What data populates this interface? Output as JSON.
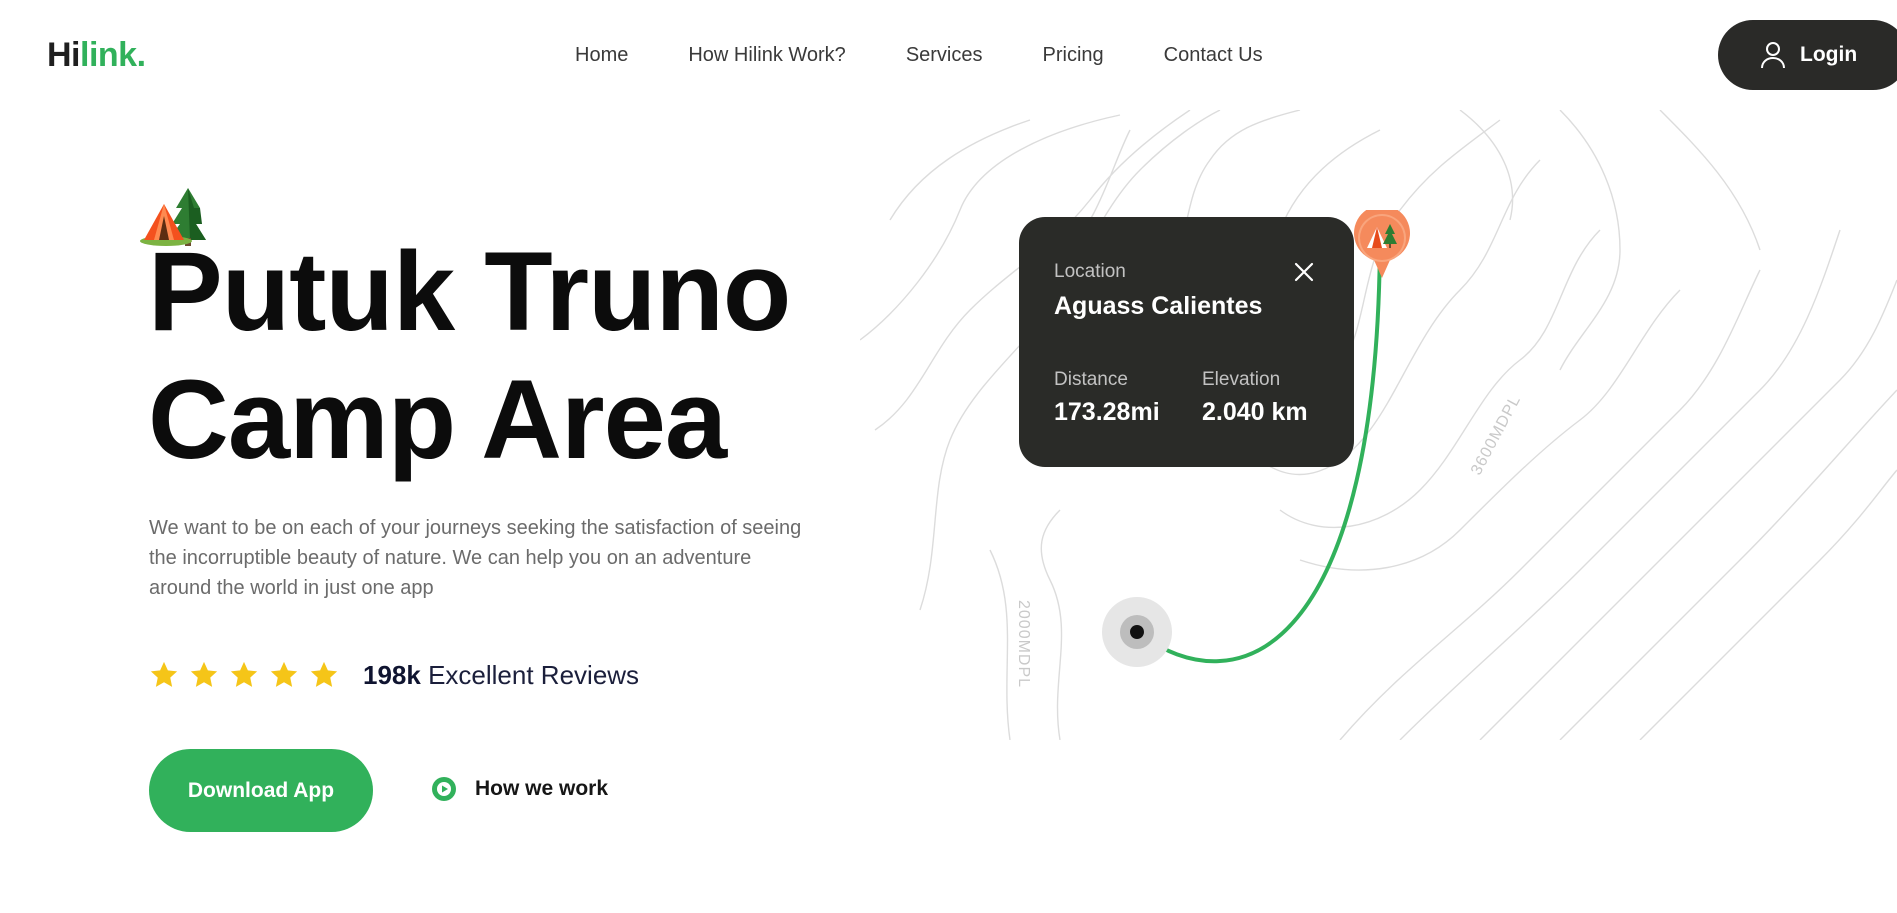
{
  "header": {
    "logo_part1": "Hi",
    "logo_part2": "link.",
    "nav": [
      "Home",
      "How Hilink Work?",
      "Services",
      "Pricing",
      "Contact Us"
    ],
    "login_label": "Login"
  },
  "hero": {
    "title_line1": "Putuk Truno",
    "title_line2": "Camp Area",
    "description": "We want to be on each of your journeys seeking the satisfaction of seeing the incorruptible beauty of nature. We can help you on an adventure around the world in just one app",
    "rating_stars": 5,
    "reviews_count": "198k",
    "reviews_label": "Excellent Reviews",
    "download_label": "Download App",
    "how_we_work_label": "How we work"
  },
  "map": {
    "altitude_labels": [
      "2000MDPL",
      "3600MDPL"
    ],
    "card": {
      "location_label": "Location",
      "location_name": "Aguass Calientes",
      "distance_label": "Distance",
      "distance_value": "173.28mi",
      "elevation_label": "Elevation",
      "elevation_value": "2.040 km"
    }
  },
  "colors": {
    "brand_green": "#31b15b",
    "dark": "#2a2b28",
    "star": "#f5c518",
    "pin_orange": "#f58a5c"
  },
  "icons": [
    "user-icon",
    "camp-icon",
    "star-icon",
    "close-icon",
    "play-icon",
    "location-pin-icon",
    "start-point-icon"
  ]
}
